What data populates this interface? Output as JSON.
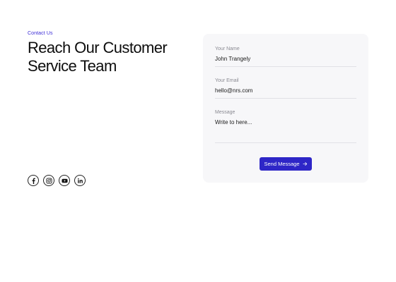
{
  "hero": {
    "eyebrow": "Contact Us",
    "title_line1": "Reach Our Customer",
    "title_line2": "Service Team"
  },
  "socials": [
    {
      "icon": "facebook-icon"
    },
    {
      "icon": "instagram-icon"
    },
    {
      "icon": "youtube-icon"
    },
    {
      "icon": "linkedin-icon"
    }
  ],
  "form": {
    "name_label": "Your Name",
    "name_value": "John Trangely",
    "email_label": "Your Email",
    "email_value": "hello@nrs.com",
    "message_label": "Message",
    "message_placeholder": "Write to here...",
    "submit_label": "Send Message"
  },
  "colors": {
    "accent": "#2e26c7",
    "eyebrow": "#3b2bd6",
    "card_background": "#f7f7f9"
  }
}
